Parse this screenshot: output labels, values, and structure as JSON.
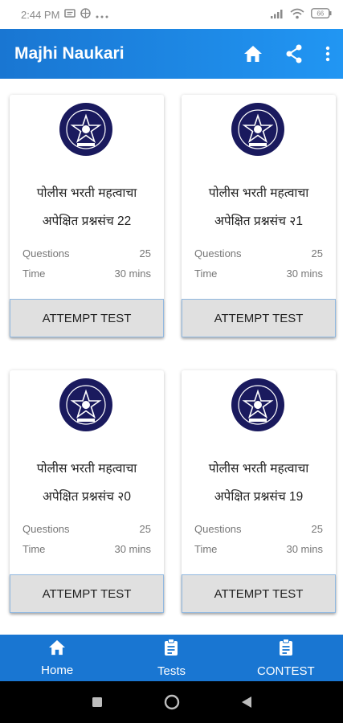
{
  "status_bar": {
    "time": "2:44 PM",
    "battery": "66"
  },
  "app_bar": {
    "title": "Majhi Naukari"
  },
  "cards": [
    {
      "title_line1": "पोलीस भरती महत्वाचा",
      "title_line2": "अपेक्षित प्रश्नसंच 22",
      "questions_label": "Questions",
      "questions_value": "25",
      "time_label": "Time",
      "time_value": "30 mins",
      "button_label": "ATTEMPT TEST"
    },
    {
      "title_line1": "पोलीस भरती महत्वाचा",
      "title_line2": "अपेक्षित प्रश्नसंच २1",
      "questions_label": "Questions",
      "questions_value": "25",
      "time_label": "Time",
      "time_value": "30 mins",
      "button_label": "ATTEMPT TEST"
    },
    {
      "title_line1": "पोलीस भरती महत्वाचा",
      "title_line2": "अपेक्षित प्रश्नसंच २0",
      "questions_label": "Questions",
      "questions_value": "25",
      "time_label": "Time",
      "time_value": "30 mins",
      "button_label": "ATTEMPT TEST"
    },
    {
      "title_line1": "पोलीस भरती महत्वाचा",
      "title_line2": "अपेक्षित प्रश्नसंच 19",
      "questions_label": "Questions",
      "questions_value": "25",
      "time_label": "Time",
      "time_value": "30 mins",
      "button_label": "ATTEMPT TEST"
    }
  ],
  "bottom_nav": {
    "home_label": "Home",
    "tests_label": "Tests",
    "contest_label": "CONTEST"
  },
  "colors": {
    "primary": "#1976d2",
    "logo_bg": "#1a1a5e",
    "button_bg": "#e0e0e0"
  },
  "icons": [
    "home-icon",
    "share-icon",
    "more-vert-icon",
    "police-badge-logo",
    "clipboard-icon",
    "recent-apps-icon",
    "home-circle-icon",
    "back-triangle-icon"
  ]
}
